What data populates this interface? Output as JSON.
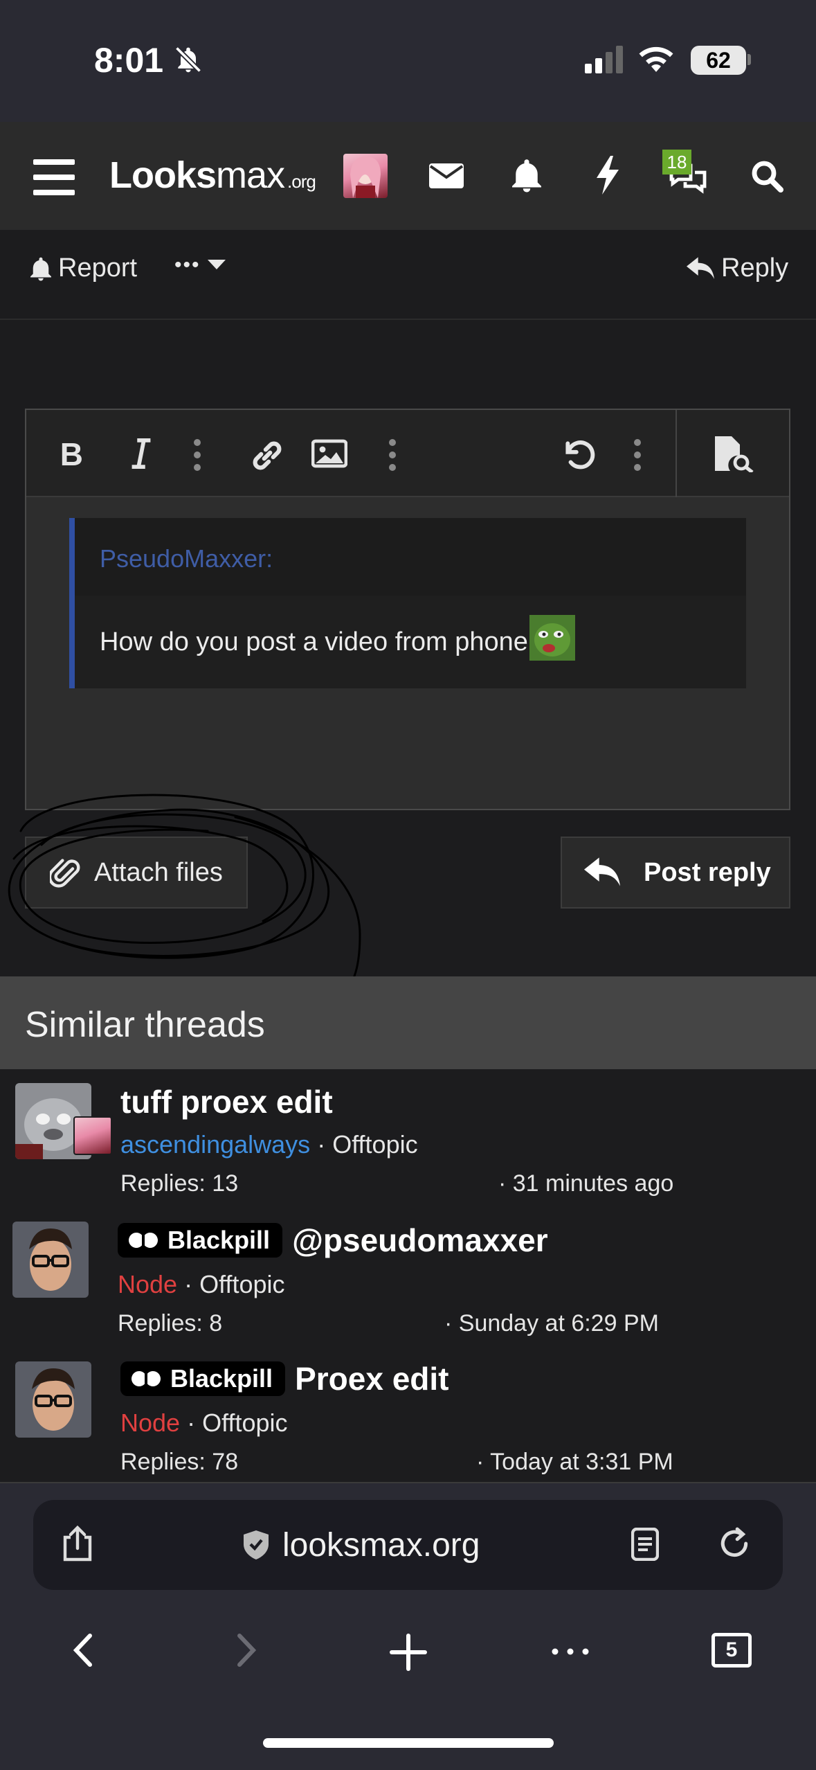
{
  "status_bar": {
    "time": "8:01",
    "battery": "62"
  },
  "nav": {
    "logo_bold": "Looks",
    "logo_light": "max",
    "logo_suffix": ".org",
    "conversations_badge": "18"
  },
  "actions": {
    "report": "Report",
    "more": "•••",
    "reply": "Reply"
  },
  "editor": {
    "quote_author": "PseudoMaxxer:",
    "quote_text": "How do you post a video from phone"
  },
  "buttons": {
    "attach": "Attach files",
    "post_reply": "Post reply"
  },
  "similar": {
    "title": "Similar threads",
    "threads": [
      {
        "prefix": "",
        "title": "tuff proex edit",
        "author": "ascendingalways",
        "forum": "Offtopic",
        "replies": "Replies: 13",
        "date": "· 31 minutes ago"
      },
      {
        "prefix": "Blackpill",
        "title": "@pseudomaxxer",
        "author": "Node",
        "forum": "Offtopic",
        "replies": "Replies: 8",
        "date": "· Sunday at 6:29 PM"
      },
      {
        "prefix": "Blackpill",
        "title": "Proex edit",
        "author": "Node",
        "forum": "Offtopic",
        "replies": "Replies: 78",
        "date": "· Today at 3:31 PM"
      }
    ],
    "separator": "·"
  },
  "browser": {
    "url": "looksmax.org",
    "tab_count": "5"
  },
  "colors": {
    "accent_blue": "#3f8fe0",
    "node_red": "#e04040",
    "badge_green": "#6aaa2c",
    "quote_border": "#2f4fa3"
  }
}
